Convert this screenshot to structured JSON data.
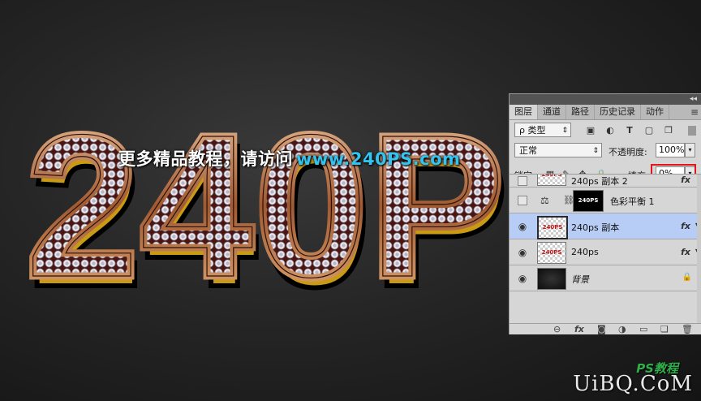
{
  "artwork": {
    "big_text": "240P",
    "banner_cn": "更多精品教程，请访问",
    "banner_url": "www.240PS.com",
    "watermark_top": "PS教程",
    "watermark": "UiBQ.CoM"
  },
  "panel": {
    "collapse": "◂◂",
    "tabs": [
      "图层",
      "通道",
      "路径",
      "历史记录",
      "动作"
    ],
    "menu_icon": "≡",
    "filter": {
      "label": "ρ 类型",
      "icons": [
        "image-filter-icon",
        "adjust-filter-icon",
        "type-filter-icon",
        "shape-filter-icon",
        "smart-filter-icon"
      ]
    },
    "blend_mode": "正常",
    "opacity_label": "不透明度:",
    "opacity_value": "100%",
    "lock_label": "锁定:",
    "fill_label": "填充:",
    "fill_value": "0%",
    "layers": [
      {
        "name": "240ps 副本 2",
        "visible": false,
        "fx": true,
        "thumb": "240PS"
      },
      {
        "name": "色彩平衡 1",
        "visible": false,
        "adjustment": true,
        "mask": "240PS"
      },
      {
        "name": "240ps 副本",
        "visible": true,
        "fx": true,
        "selected": true,
        "thumb": "240PS"
      },
      {
        "name": "240ps",
        "visible": true,
        "fx": true,
        "thumb": "240PS"
      },
      {
        "name": "背景",
        "visible": true,
        "locked": true,
        "background": true
      }
    ],
    "bottom_icons": [
      "link-icon",
      "fx-icon",
      "mask-icon",
      "adjustment-icon",
      "group-icon",
      "new-layer-icon",
      "trash-icon"
    ]
  }
}
